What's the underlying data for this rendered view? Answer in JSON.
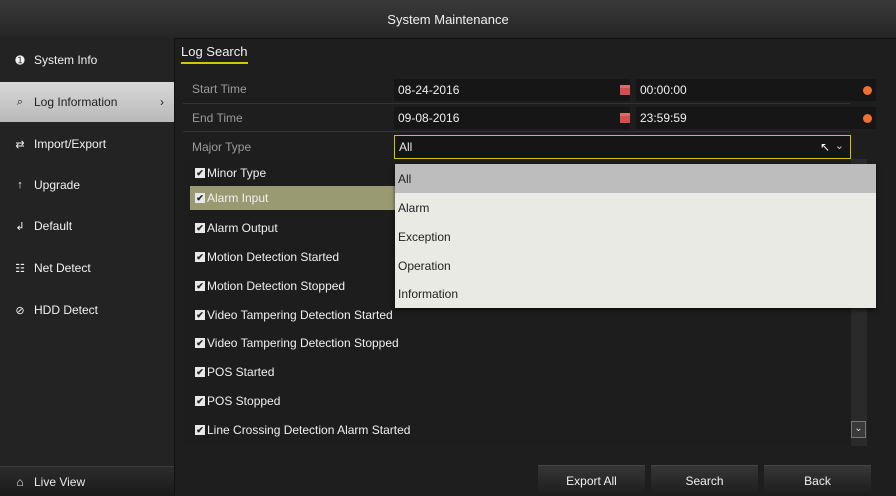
{
  "window": {
    "title": "System Maintenance"
  },
  "sidebar": {
    "items": [
      {
        "label": "System Info",
        "icon": "info-icon"
      },
      {
        "label": "Log Information",
        "icon": "magnifier-icon",
        "active": true
      },
      {
        "label": "Import/Export",
        "icon": "import-export-icon"
      },
      {
        "label": "Upgrade",
        "icon": "upgrade-arrow-icon"
      },
      {
        "label": "Default",
        "icon": "default-reset-icon"
      },
      {
        "label": "Net Detect",
        "icon": "network-icon"
      },
      {
        "label": "HDD Detect",
        "icon": "hdd-icon"
      }
    ],
    "live_view": "Live View"
  },
  "tab": {
    "label": "Log Search"
  },
  "form": {
    "start_time_label": "Start Time",
    "start_date": "08-24-2016",
    "start_clock": "00:00:00",
    "end_time_label": "End Time",
    "end_date": "09-08-2016",
    "end_clock": "23:59:59",
    "major_type_label": "Major Type",
    "major_type_value": "All"
  },
  "minor_types": {
    "header": "Minor Type",
    "items": [
      "Alarm Input",
      "Alarm Output",
      "Motion Detection Started",
      "Motion Detection Stopped",
      "Video Tampering Detection Started",
      "Video Tampering Detection Stopped",
      "POS Started",
      "POS Stopped",
      "Line Crossing Detection Alarm Started"
    ]
  },
  "dropdown": {
    "options": [
      "All",
      "Alarm",
      "Exception",
      "Operation",
      "Information"
    ],
    "selected": "All"
  },
  "buttons": {
    "export_all": "Export All",
    "search": "Search",
    "back": "Back"
  },
  "colors": {
    "accent": "#d5c200",
    "highlight_row": "#9a9a72",
    "dropdown_bg": "#eaeae4"
  }
}
